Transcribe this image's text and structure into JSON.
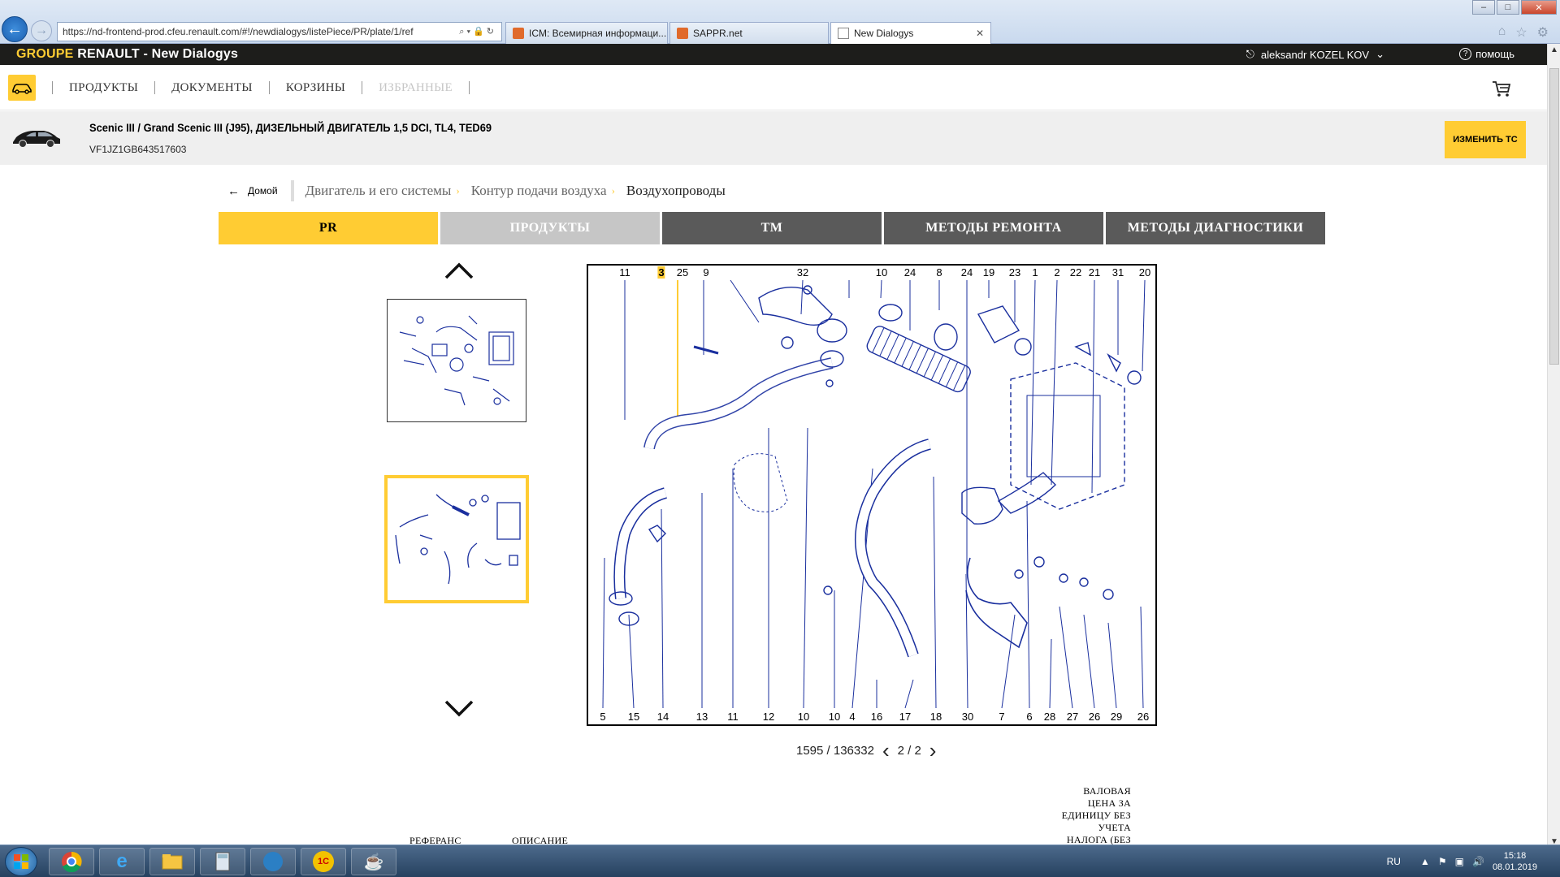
{
  "browser": {
    "url": "https://nd-frontend-prod.cfeu.renault.com/#!/newdialogys/listePiece/PR/plate/1/ref",
    "tabs": [
      {
        "label": "ICM: Всемирная информаци..."
      },
      {
        "label": "SAPPR.net"
      },
      {
        "label": "New Dialogys"
      }
    ]
  },
  "header": {
    "brand_groupe": "GROUPE",
    "brand_rest": " RENAULT - New Dialogys",
    "user": "aleksandr KOZEL KOV",
    "help": "помощь"
  },
  "menu": {
    "items": [
      {
        "label": "ПРОДУКТЫ"
      },
      {
        "label": "ДОКУМЕНТЫ"
      },
      {
        "label": "КОРЗИНЫ"
      },
      {
        "label": "ИЗБРАННЫЕ"
      }
    ]
  },
  "vehicle": {
    "title": "Scenic III / Grand Scenic III (J95), ДИЗЕЛЬНЫЙ ДВИГАТЕЛЬ 1,5 DCI, TL4, TED69",
    "vin": "VF1JZ1GB643517603",
    "change_label": "ИЗМЕНИТЬ ТС"
  },
  "breadcrumb": {
    "home": "Домой",
    "items": [
      "Двигатель и его системы",
      "Контур подачи воздуха",
      "Воздухопроводы"
    ]
  },
  "tabs": [
    {
      "label": "PR"
    },
    {
      "label": "ПРОДУКТЫ"
    },
    {
      "label": "TM"
    },
    {
      "label": "МЕТОДЫ РЕМОНТА"
    },
    {
      "label": "МЕТОДЫ ДИАГНОСТИКИ"
    }
  ],
  "diagram": {
    "top_callouts": [
      "11",
      "3",
      "25",
      "9",
      "32",
      "10",
      "24",
      "8",
      "24",
      "19",
      "23",
      "1",
      "2",
      "22",
      "21",
      "31",
      "20"
    ],
    "bottom_callouts": [
      "5",
      "15",
      "14",
      "13",
      "11",
      "12",
      "10",
      "10",
      "4",
      "16",
      "17",
      "18",
      "30",
      "7",
      "6",
      "28",
      "27",
      "26",
      "29",
      "26"
    ],
    "highlighted": "3"
  },
  "pager": {
    "ref": "1595 / 136332",
    "page": "2 / 2"
  },
  "table": {
    "col_ref": "РЕФЕРАНС",
    "col_desc": "ОПИСАНИЕ",
    "col_price": "ВАЛОВАЯ ЦЕНА ЗА ЕДИНИЦУ БЕЗ УЧЕТА НАЛОГА (БЕЗ"
  },
  "taskbar": {
    "lang": "RU",
    "time": "15:18",
    "date": "08.01.2019"
  },
  "colors": {
    "accent": "#ffcc33",
    "header_bg": "#1d1d1b",
    "tab_dark": "#5a5a5a",
    "tab_inactive": "#c6c6c6",
    "diagram_line": "#1a2f9e"
  }
}
